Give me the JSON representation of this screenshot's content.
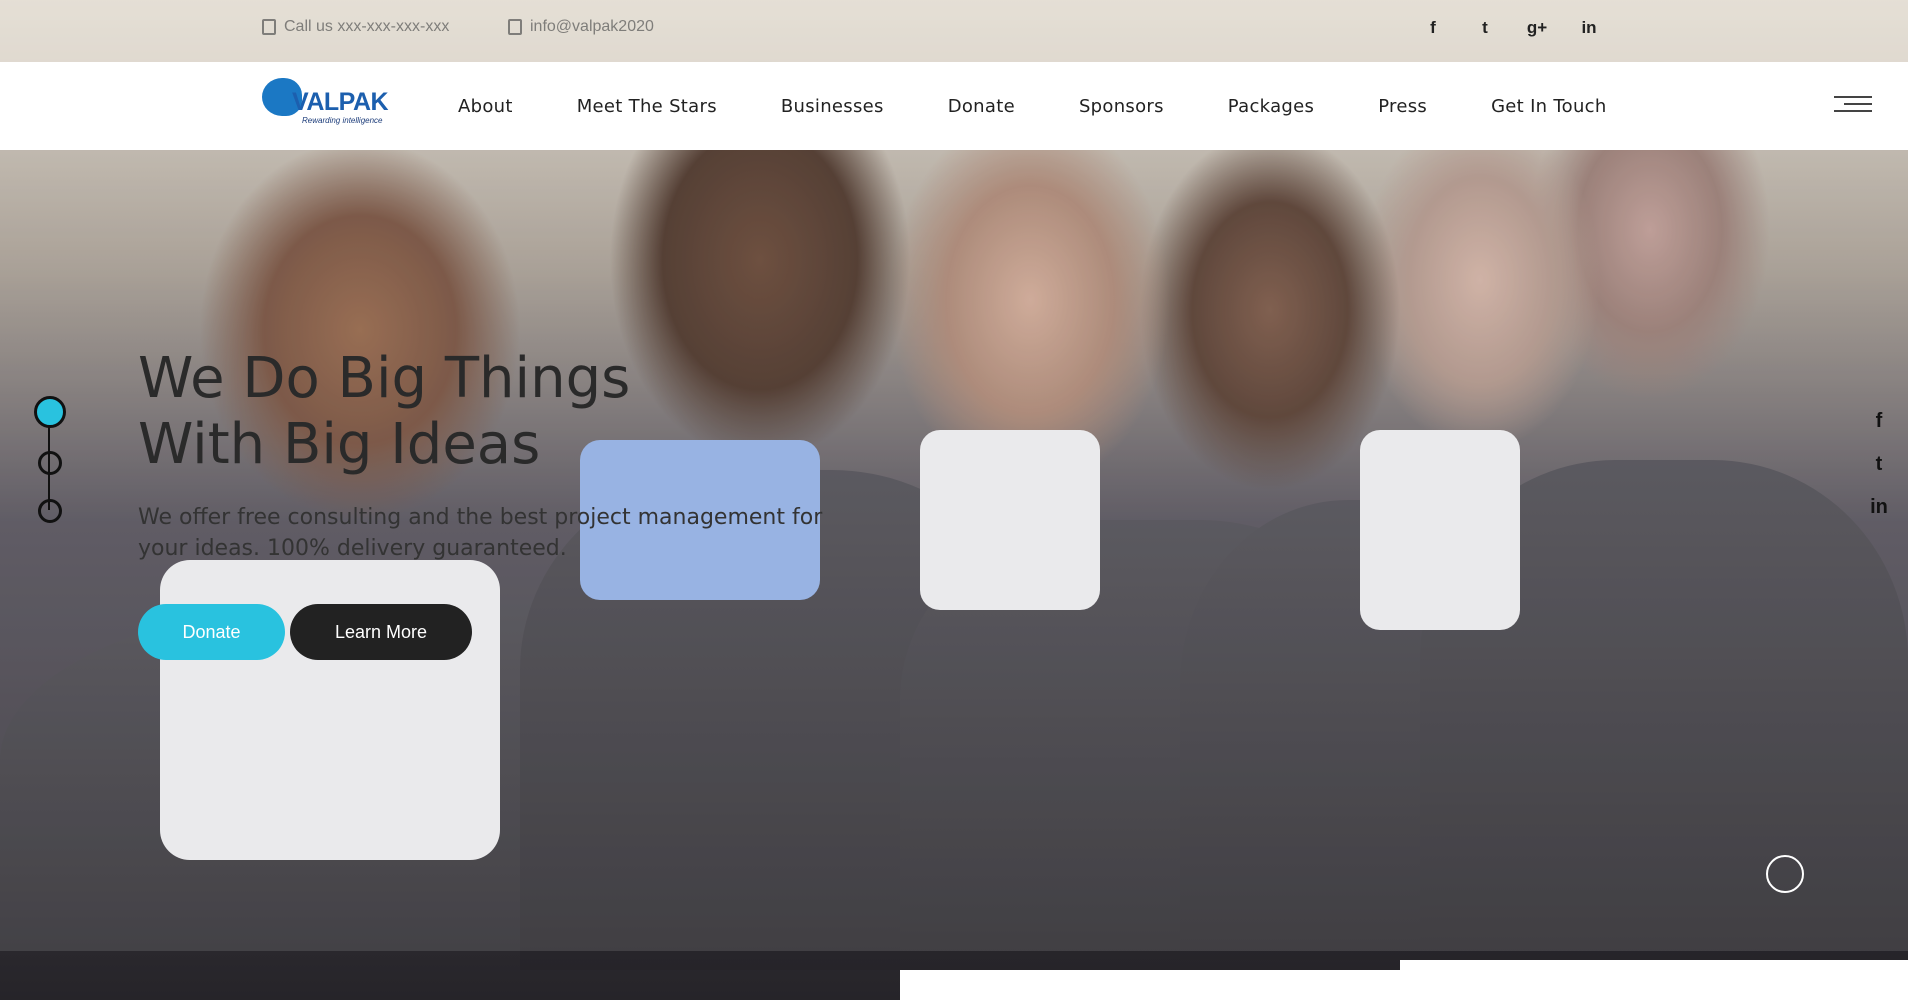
{
  "topbar": {
    "phone": "Call us xxx-xxx-xxx-xxx",
    "email": "info@valpak2020",
    "social": [
      "f",
      "t",
      "g+",
      "in"
    ]
  },
  "brand": {
    "name": "VALPAK",
    "tagline": "Rewarding intelligence",
    "accent": "#29c2df",
    "logo_color": "#1c5fae"
  },
  "nav": {
    "items": [
      "About",
      "Meet The Stars",
      "Businesses",
      "Donate",
      "Sponsors",
      "Packages",
      "Press",
      "Get In Touch"
    ]
  },
  "hero": {
    "title_line1": "We Do Big Things",
    "title_line2": "With Big Ideas",
    "subtitle": "We offer free consulting and the best project management for your ideas. 100% delivery guaranteed.",
    "donate_label": "Donate",
    "learn_label": "Learn More",
    "slides": 3,
    "active_slide": 1
  },
  "side_social": [
    "f",
    "t",
    "in"
  ]
}
